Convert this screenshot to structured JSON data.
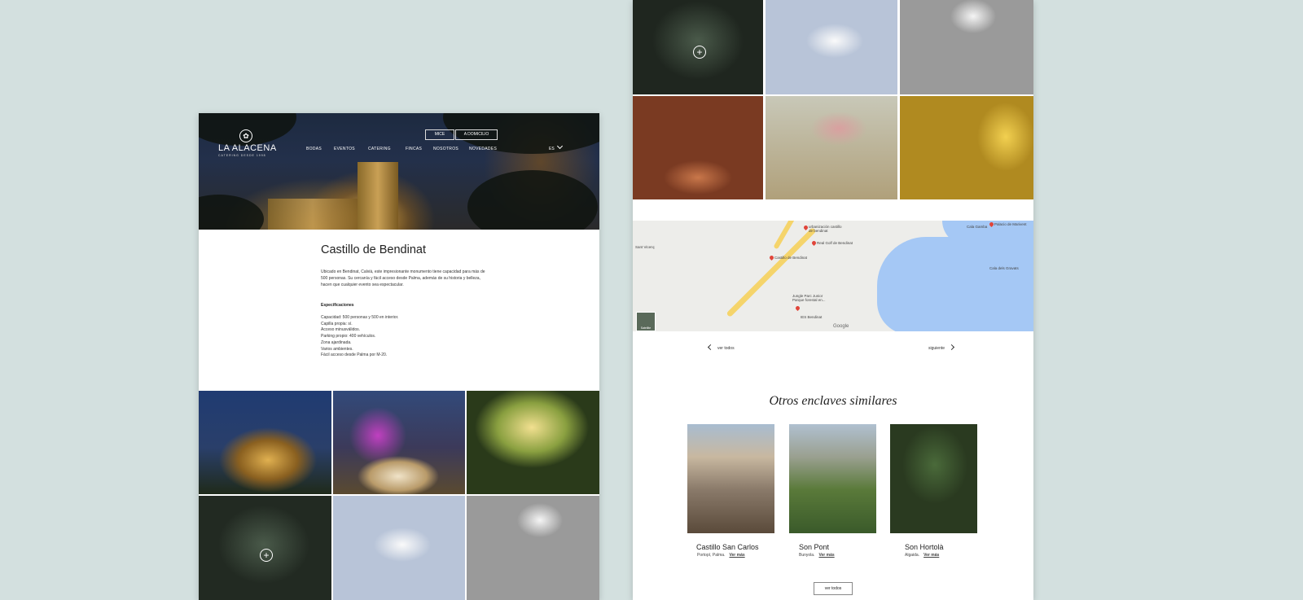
{
  "header": {
    "logo": "LA ALACENA",
    "logo_sub": "CATERING DESDE 1998",
    "top_buttons": [
      "MICE",
      "A DOMICILIO"
    ],
    "nav": [
      "BODAS",
      "EVENTOS",
      "CATERING",
      "FINCAS",
      "NOSOTROS",
      "NOVEDADES"
    ],
    "lang": "ES"
  },
  "venue": {
    "title": "Castillo de Bendinat",
    "description": "Ubicado en Bendinat, Calvià, este impresionante monumento tiene capacidad para más de 500 personas. Su cercanía y fácil acceso desde Palma, además de su historia y belleza, hacen que cualquier evento sea espectacular.",
    "specs_heading": "Especificaciones",
    "specs": [
      "Capacidad: 500 personas y 500 en interior.",
      "Capilla propia: sí.",
      "Acceso minusválidos.",
      "Parking propio: 400 vehículos.",
      "Zona ajardinada.",
      "Varios ambientes.",
      "Fácil acceso desde Palma por M-20."
    ]
  },
  "map": {
    "labels": [
      "urbanización castillo de bendinat",
      "Real Golf de Bendinat",
      "Castillo de Bendinat",
      "Jungle Parc Junior Parque forestal en...",
      "IES Bendinat",
      "Palacio de Marivent",
      "Cala Gamba",
      "Cala dels Gravats",
      "Sant Vicenç",
      "Satellite",
      "Google"
    ]
  },
  "pagination": {
    "prev": "ver todos",
    "next": "siguiente"
  },
  "similar": {
    "heading": "Otros enclaves similares",
    "cards": [
      {
        "name": "Castillo San Carlos",
        "location": "Portopí, Palma.",
        "link": "Ver más"
      },
      {
        "name": "Son Pont",
        "location": "Bunyola.",
        "link": "Ver más"
      },
      {
        "name": "Son Hortolà",
        "location": "Algaida.",
        "link": "Ver más"
      }
    ],
    "button": "ver todos"
  },
  "icons": [
    "plus-circle-icon",
    "chevron-down-icon",
    "chevron-left-icon",
    "chevron-right-icon",
    "map-pin-icon"
  ],
  "colors": {
    "background": "#d3e0df",
    "map_sea": "#a5c8f5",
    "pin": "#e0453a"
  }
}
